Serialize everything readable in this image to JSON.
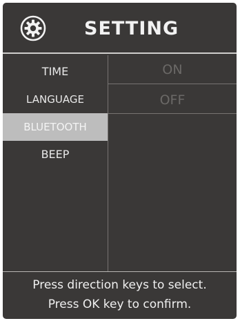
{
  "header": {
    "icon": "gear-icon",
    "title": "SETTING"
  },
  "menu": {
    "items": [
      {
        "label": "TIME",
        "selected": false
      },
      {
        "label": "LANGUAGE",
        "selected": false
      },
      {
        "label": "BLUETOOTH",
        "selected": true
      },
      {
        "label": "BEEP",
        "selected": false
      }
    ]
  },
  "options": {
    "items": [
      {
        "label": "ON"
      },
      {
        "label": "OFF"
      }
    ]
  },
  "footer": {
    "line1": "Press direction keys to select.",
    "line2": "Press OK key to confirm."
  },
  "colors": {
    "background": "#3a3837",
    "selected_bg": "#bdbdbd",
    "text": "#e8e8e8",
    "option_text": "#6b6967",
    "divider": "#777472"
  }
}
